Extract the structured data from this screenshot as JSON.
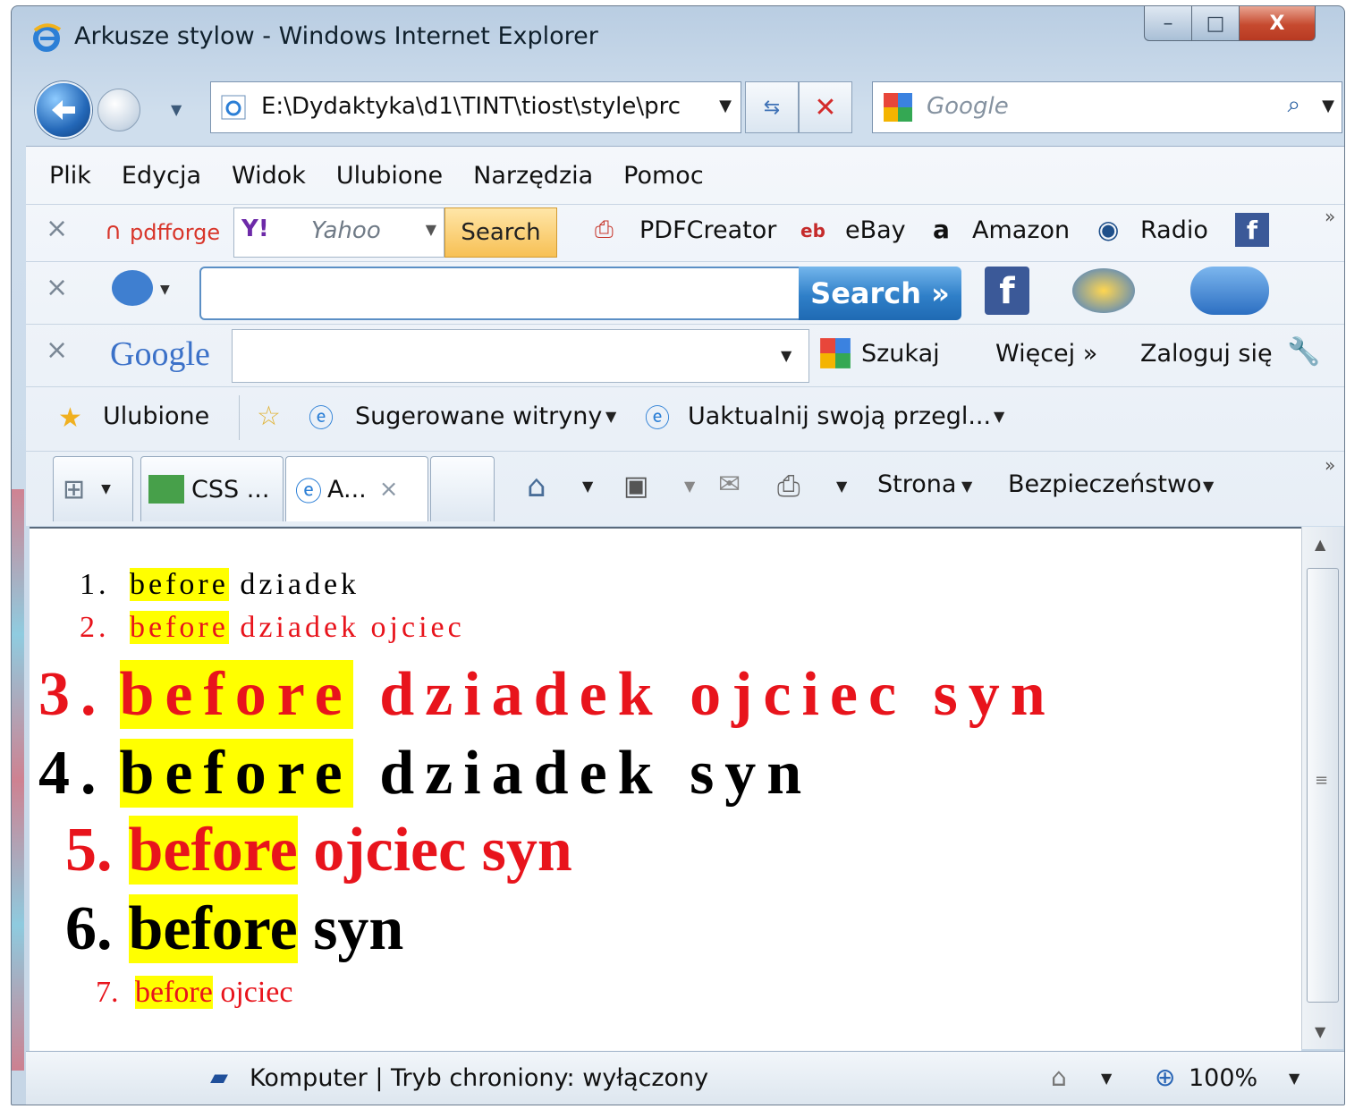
{
  "window": {
    "title": "Arkusze stylow - Windows Internet Explorer",
    "buttons": {
      "minimize": "–",
      "maximize": "□",
      "close": "X"
    }
  },
  "address_bar": {
    "url": "E:\\Dydaktyka\\d1\\TINT\\tiost\\style\\prc"
  },
  "search_box": {
    "placeholder": "Google"
  },
  "menu": [
    "Plik",
    "Edycja",
    "Widok",
    "Ulubione",
    "Narzędzia",
    "Pomoc"
  ],
  "toolbar1": {
    "pdfforge": "pdfforge",
    "yahoo_placeholder": "Yahoo",
    "search_button": "Search",
    "items": [
      "PDFCreator",
      "eBay",
      "Amazon",
      "Radio"
    ]
  },
  "toolbar2": {
    "search_button": "Search »"
  },
  "toolbar3": {
    "logo": "Google",
    "szukaj": "Szukaj",
    "wiecej": "Więcej »",
    "zaloguj": "Zaloguj się"
  },
  "favorites_bar": {
    "ulubione": "Ulubione",
    "items": [
      "Sugerowane witryny",
      "Uaktualnij swoją przegl..."
    ]
  },
  "tabs": [
    "CSS ...",
    "A..."
  ],
  "command_bar": {
    "strona": "Strona",
    "bezpieczenstwo": "Bezpieczeństwo"
  },
  "page": {
    "items": [
      {
        "num": "1.",
        "before": "before",
        "rest": "dziadek",
        "color": "#000000"
      },
      {
        "num": "2.",
        "before": "before",
        "rest": "dziadek ojciec",
        "color": "#e8141c"
      },
      {
        "num": "3.",
        "before": "before",
        "rest": "dziadek ojciec syn",
        "color": "#e8141c"
      },
      {
        "num": "4.",
        "before": "before",
        "rest": "dziadek syn",
        "color": "#000000"
      },
      {
        "num": "5.",
        "before": "before",
        "rest": "ojciec syn",
        "color": "#e8141c"
      },
      {
        "num": "6.",
        "before": "before",
        "rest": "syn",
        "color": "#000000"
      },
      {
        "num": "7.",
        "before": "before",
        "rest": "ojciec",
        "color": "#e8141c"
      }
    ]
  },
  "status_bar": {
    "text": "Komputer | Tryb chroniony: wyłączony",
    "zoom": "100%"
  }
}
